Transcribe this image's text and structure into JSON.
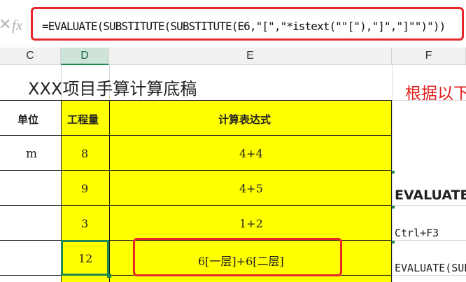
{
  "formula_bar": {
    "cancel_icon": "x-glyph",
    "fx_label": "fx",
    "formula": "=EVALUATE(SUBSTITUTE(SUBSTITUTE(E6,\"[\",\"*istext(\"\"[\"),\"]\",\"]\"\")\"))",
    "highlight_color": "#e8262a"
  },
  "columns": [
    "C",
    "D",
    "E",
    "F"
  ],
  "selected_column": "D",
  "sheet": {
    "title": "XXX项目手算计算底稿",
    "note": "根据以下",
    "headers": {
      "unit": "单位",
      "quantity": "工程量",
      "expression": "计算表达式"
    },
    "rows": [
      {
        "unit": "m",
        "quantity": "8",
        "expression": "4+4",
        "side": ""
      },
      {
        "unit": "",
        "quantity": "9",
        "expression": "4+5",
        "side": "EVALUATE"
      },
      {
        "unit": "",
        "quantity": "3",
        "expression": "1+2",
        "side": "Ctrl+F3"
      },
      {
        "unit": "",
        "quantity": "12",
        "expression": "6[一层]+6[二层]",
        "side": "EVALUATE(SUBS"
      }
    ]
  },
  "colors": {
    "table_fill": "#ffff00",
    "selection": "#1f8a4f",
    "annotation": "#e0201f"
  }
}
